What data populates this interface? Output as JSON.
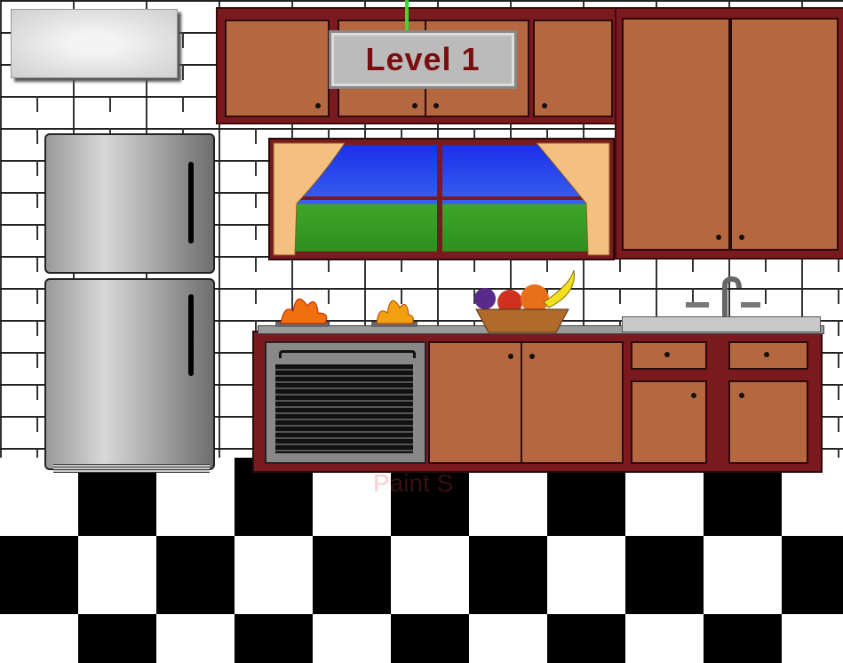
{
  "hud": {
    "level_label": "Level 1"
  },
  "watermark": {
    "text": "Paint S"
  },
  "scene": {
    "objects": [
      "light-panel",
      "refrigerator",
      "upper-cabinets",
      "tall-cabinet",
      "window",
      "stove",
      "burner-fire",
      "fruit-basket",
      "sink",
      "lower-cabinets",
      "checkered-floor"
    ]
  },
  "colors": {
    "cabinet_wood": "#b5673f",
    "cabinet_frame": "#7a1a1e",
    "level_text": "#7a0e0e",
    "sky": "#1a30e8",
    "grass": "#3fa52a"
  }
}
